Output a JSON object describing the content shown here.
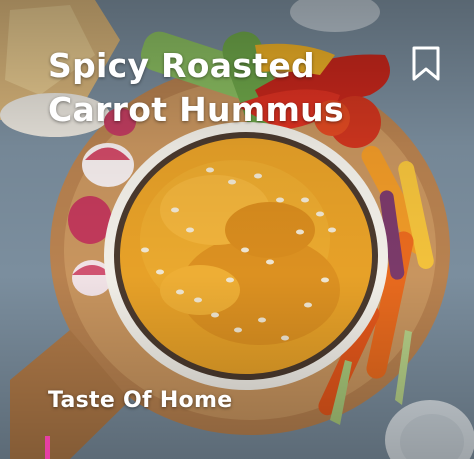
{
  "card": {
    "title_lines": [
      "Spicy Roasted",
      "Carrot Hummus"
    ],
    "source": "Taste Of Home",
    "bookmark_icon": "bookmark-icon",
    "image_icon": "hummus-photo",
    "accent_color": "#e63fa5"
  }
}
